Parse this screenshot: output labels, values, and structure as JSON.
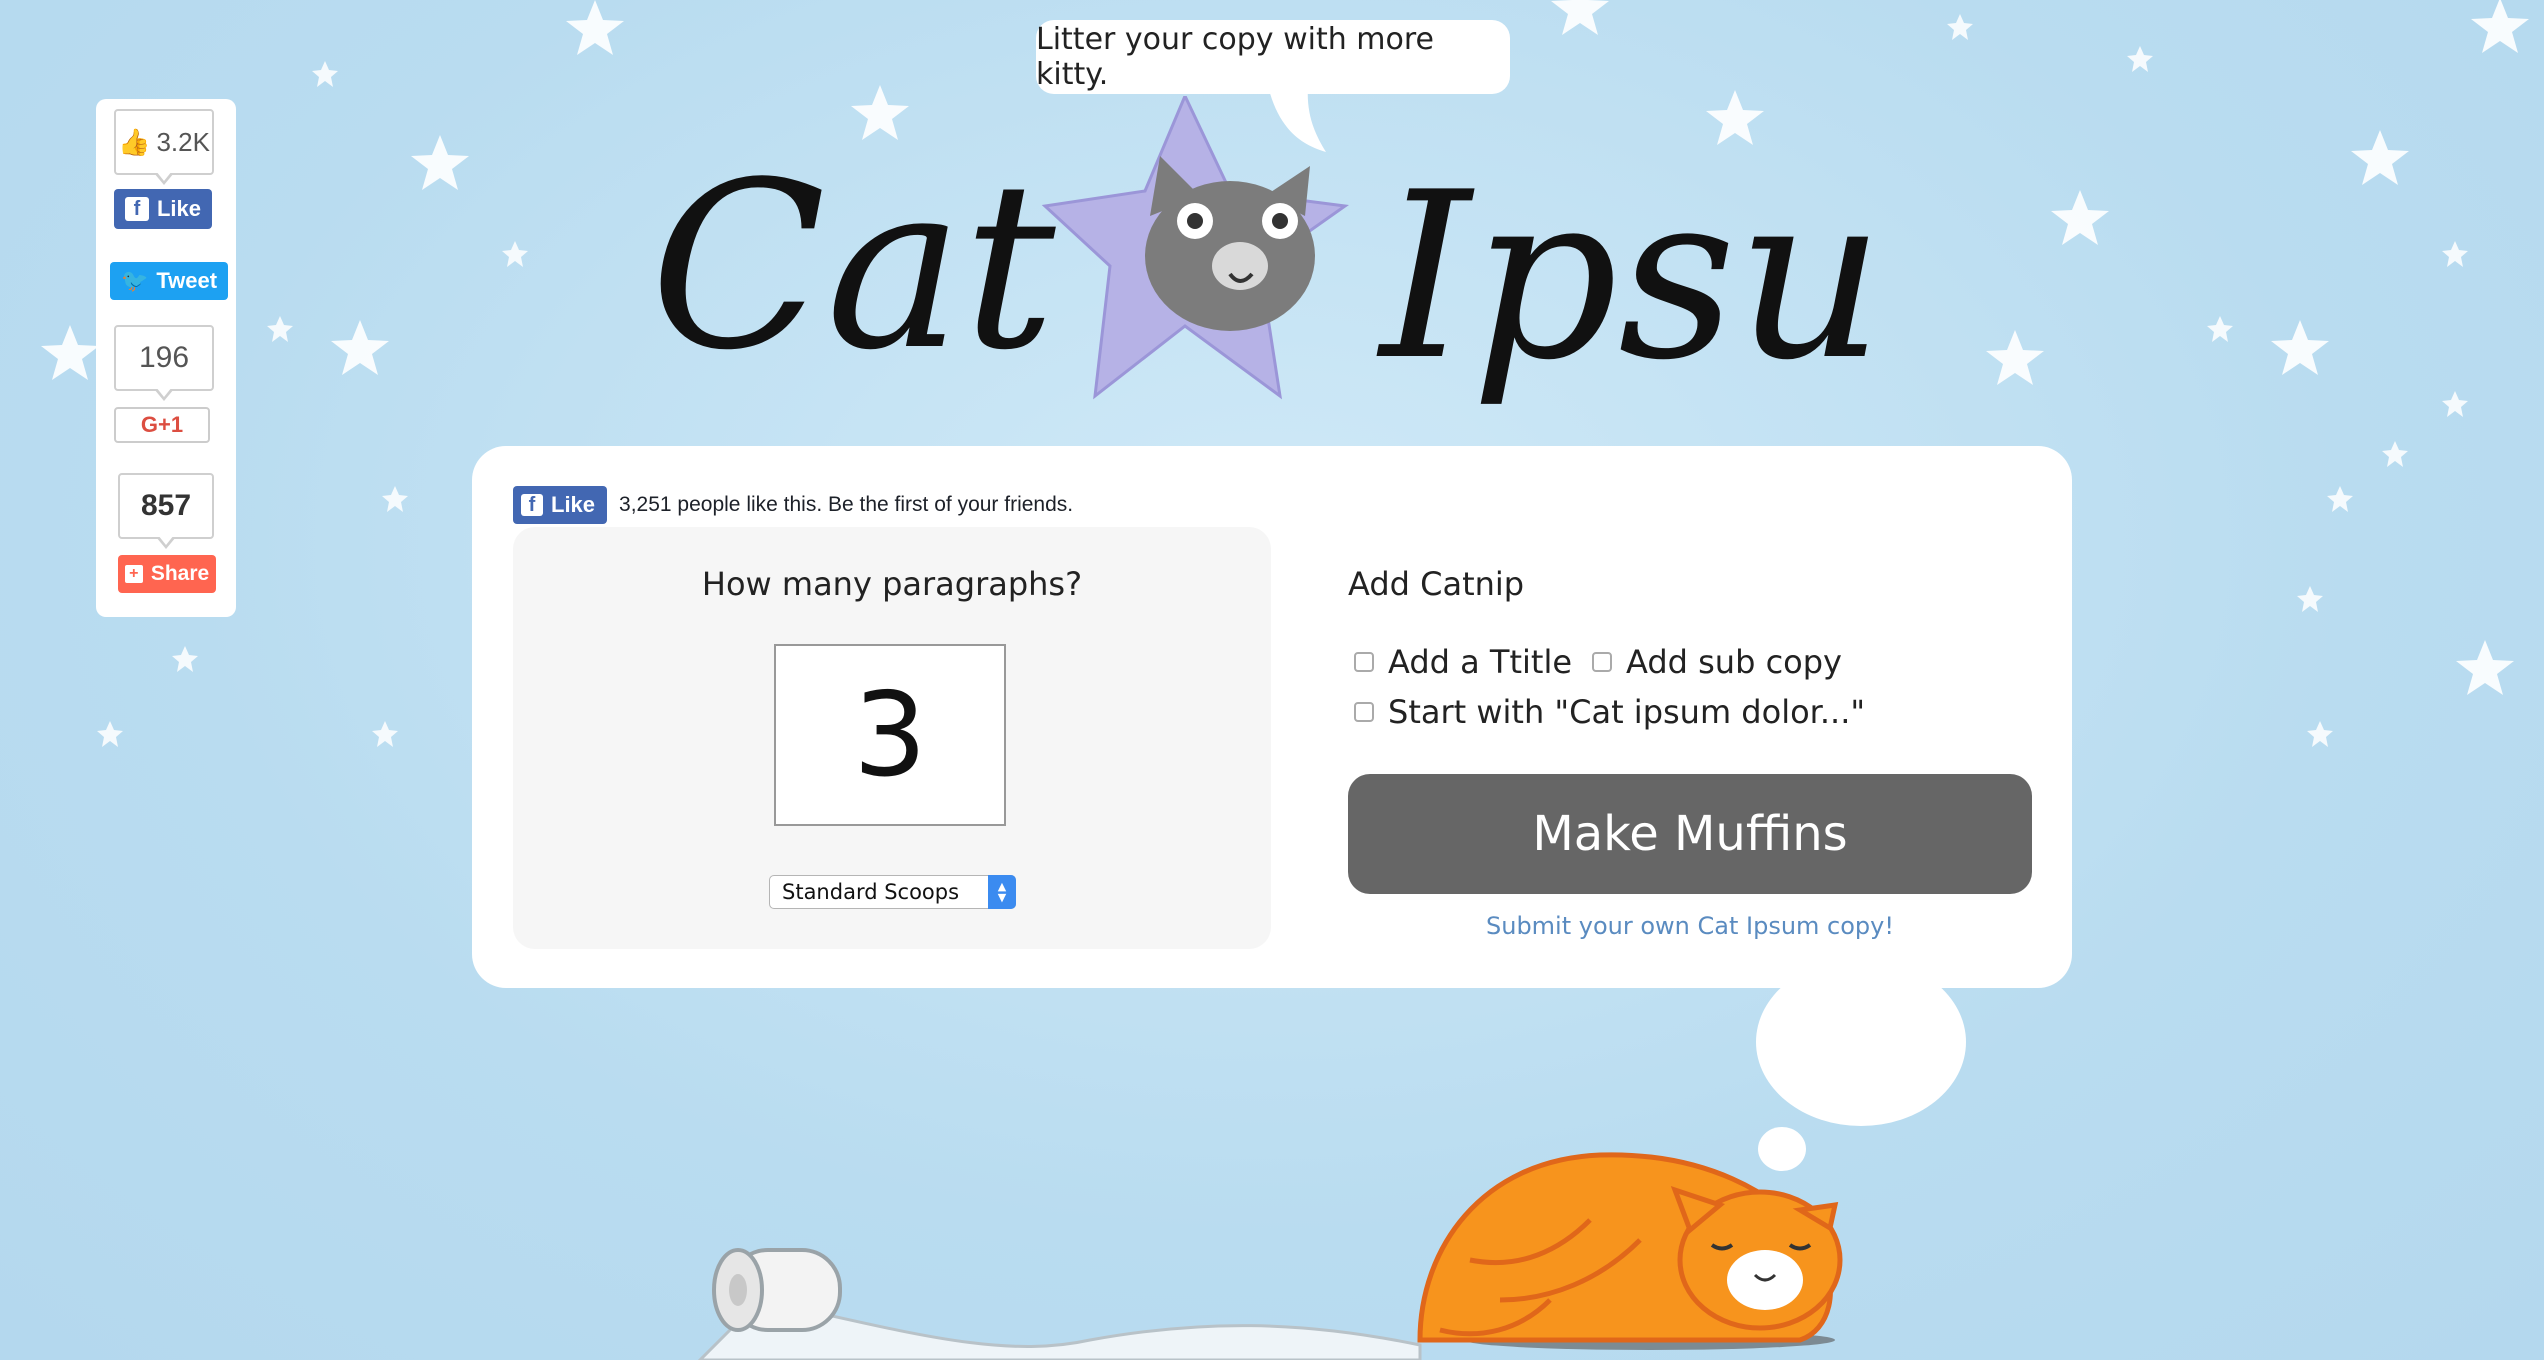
{
  "tagline": "Litter your copy with more kitty.",
  "logo": {
    "word1": "Cat",
    "word2": "Ipsum"
  },
  "share_sidebar": {
    "facebook": {
      "count": "3.2K",
      "label": "Like"
    },
    "twitter": {
      "label": "Tweet"
    },
    "google": {
      "count": "196",
      "label": "G+1"
    },
    "share": {
      "count": "857",
      "label": "Share"
    }
  },
  "fb_inline": {
    "button_label": "Like",
    "text": "3,251 people like this. Be the first of your friends."
  },
  "paragraphs": {
    "question": "How many paragraphs?",
    "value": "3",
    "select_value": "Standard Scoops"
  },
  "catnip": {
    "title": "Add Catnip",
    "options": [
      {
        "label": "Add a Ttitle",
        "checked": false
      },
      {
        "label": "Add sub copy",
        "checked": false
      },
      {
        "label": "Start with \"Cat ipsum dolor...\"",
        "checked": false
      }
    ]
  },
  "generate_button": "Make Muffins",
  "submit_link": "Submit your own Cat Ipsum copy!",
  "colors": {
    "background": "#bfe0f2",
    "facebook": "#4267b2",
    "twitter": "#1da1f2",
    "google": "#dc4e41",
    "share": "#ff6550",
    "button": "#666666",
    "link": "#5a8bc0",
    "cat_orange": "#f7941d"
  }
}
